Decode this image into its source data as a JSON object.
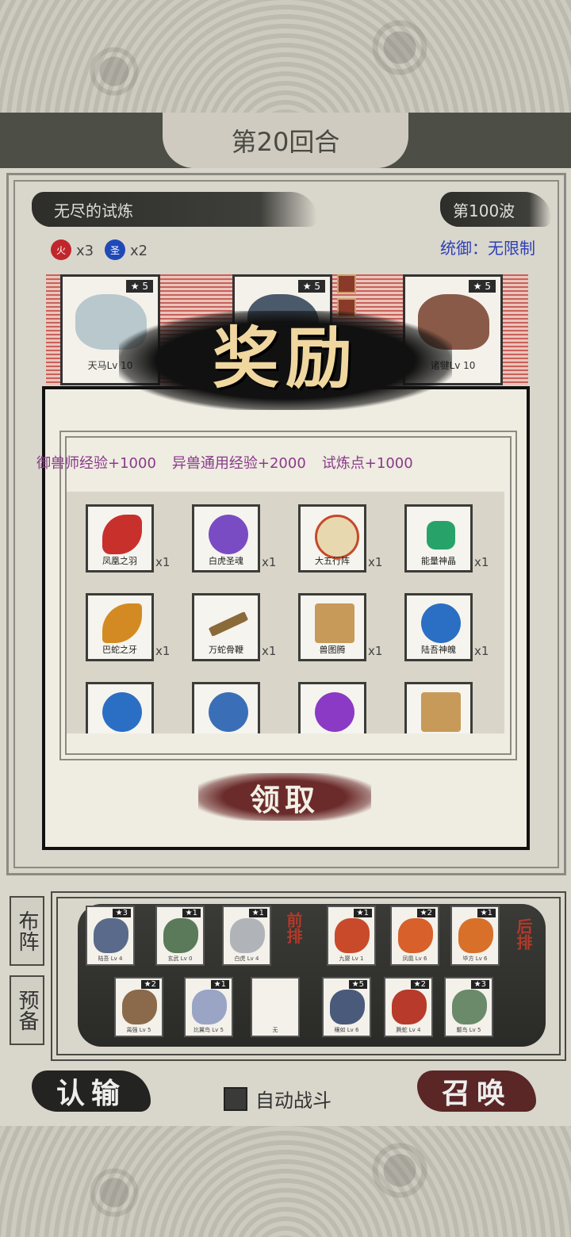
{
  "round": {
    "label": "第20回合"
  },
  "stage": {
    "name": "无尽的试炼",
    "wave": "第100波",
    "command": "统御：无限制"
  },
  "elements": [
    {
      "symbol": "火",
      "count": "x3",
      "color": "#c0262b"
    },
    {
      "symbol": "圣",
      "count": "x2",
      "color": "#2049b8"
    }
  ],
  "enemies": [
    {
      "name": "天马Lv 10",
      "level": "5",
      "hp": "0"
    },
    {
      "name": "",
      "level": "5",
      "hp": ""
    },
    {
      "name": "诸犍Lv 10",
      "level": "5",
      "hp": "0"
    }
  ],
  "reward": {
    "title": "奖励",
    "exp": [
      "御兽师经验+1000",
      "异兽通用经验+2000",
      "试炼点+1000"
    ],
    "items": [
      {
        "name": "凤凰之羽",
        "qty": "x1",
        "color": "#c8302c"
      },
      {
        "name": "白虎圣魂",
        "qty": "x1",
        "color": "#7a4cc4"
      },
      {
        "name": "大五行阵",
        "qty": "x1",
        "color": "#c44a2a"
      },
      {
        "name": "能量神晶",
        "qty": "x1",
        "color": "#27a36a"
      },
      {
        "name": "巴蛇之牙",
        "qty": "x1",
        "color": "#d48a22"
      },
      {
        "name": "万蛇骨鞭",
        "qty": "x1",
        "color": "#8b6a3a"
      },
      {
        "name": "兽图腾",
        "qty": "x1",
        "color": "#c79a5a"
      },
      {
        "name": "陆吾神魄",
        "qty": "x1",
        "color": "#2b6fc4"
      },
      {
        "name": "",
        "qty": "",
        "color": "#2b6fc4"
      },
      {
        "name": "",
        "qty": "",
        "color": "#3a6fb8"
      },
      {
        "name": "",
        "qty": "",
        "color": "#8a3ac4"
      },
      {
        "name": "",
        "qty": "",
        "color": "#c79a5a"
      }
    ],
    "claim": "领取"
  },
  "tabs": {
    "formation": "布阵",
    "reserve": "预备"
  },
  "front_label": "前排",
  "back_label": "后排",
  "front_row": [
    {
      "name": "陆吾 Lv 4",
      "level": "3"
    },
    {
      "name": "玄武 Lv 0",
      "level": "1"
    },
    {
      "name": "白虎 Lv 4",
      "level": "1"
    }
  ],
  "back_row": [
    {
      "name": "九婴 Lv 1",
      "level": "1"
    },
    {
      "name": "凤凰 Lv 6",
      "level": "2"
    },
    {
      "name": "毕方 Lv 6",
      "level": "1"
    }
  ],
  "reserve_left": [
    {
      "name": "禺强 Lv 5",
      "level": "2"
    },
    {
      "name": "比翼鸟 Lv 5",
      "level": "1"
    },
    {
      "name": "无",
      "level": ""
    }
  ],
  "reserve_right": [
    {
      "name": "穰如 Lv 6",
      "level": "5"
    },
    {
      "name": "腾蛇 Lv 4",
      "level": "2"
    },
    {
      "name": "颙鸟 Lv 5",
      "level": "3"
    }
  ],
  "buttons": {
    "surrender": "认输",
    "summon": "召唤",
    "auto": "自动战斗"
  }
}
